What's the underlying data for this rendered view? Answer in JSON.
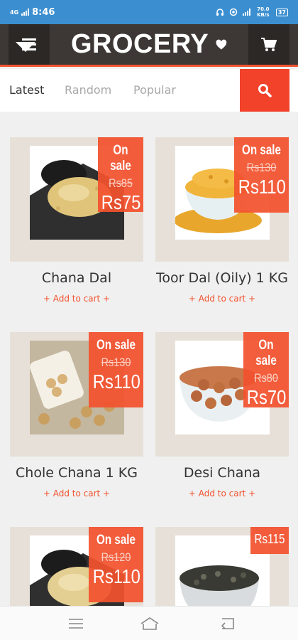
{
  "status_bar": {
    "network": "4G",
    "time": "8:46",
    "speed": "70.0 KB/s",
    "battery": "37"
  },
  "header": {
    "menu_icon": "hamburger-menu-icon",
    "title": "GROCERY",
    "heart_icon": "heart-icon",
    "cart_icon": "shopping-cart-icon"
  },
  "tabs": [
    {
      "label": "Latest",
      "active": true
    },
    {
      "label": "Random",
      "active": false
    },
    {
      "label": "Popular",
      "active": false
    }
  ],
  "search_icon": "search-icon",
  "colors": {
    "accent": "#f2522e",
    "header_bg": "#3d3836",
    "status_bar": "#3b8fd0",
    "card_bg": "#e6e0d8"
  },
  "products": [
    {
      "name": "Chana Dal",
      "sale_label": "On sale",
      "old_price": "Rs85",
      "price": "Rs75",
      "add_label": "+ Add to cart +"
    },
    {
      "name": "Toor Dal (Oily) 1 KG",
      "sale_label": "On sale",
      "old_price": "Rs130",
      "price": "Rs110",
      "add_label": "+ Add to cart +"
    },
    {
      "name": "Chole Chana 1 KG",
      "sale_label": "On sale",
      "old_price": "Rs130",
      "price": "Rs110",
      "add_label": "+ Add to cart +"
    },
    {
      "name": "Desi Chana",
      "sale_label": "On sale",
      "old_price": "Rs80",
      "price": "Rs70",
      "add_label": "+ Add to cart +"
    },
    {
      "sale_label": "On sale",
      "old_price": "Rs120",
      "price": "Rs110"
    },
    {
      "price": "Rs115"
    }
  ],
  "bottom_nav": {
    "menu_icon": "recent-apps-icon",
    "home_icon": "home-icon",
    "back_icon": "back-icon"
  }
}
